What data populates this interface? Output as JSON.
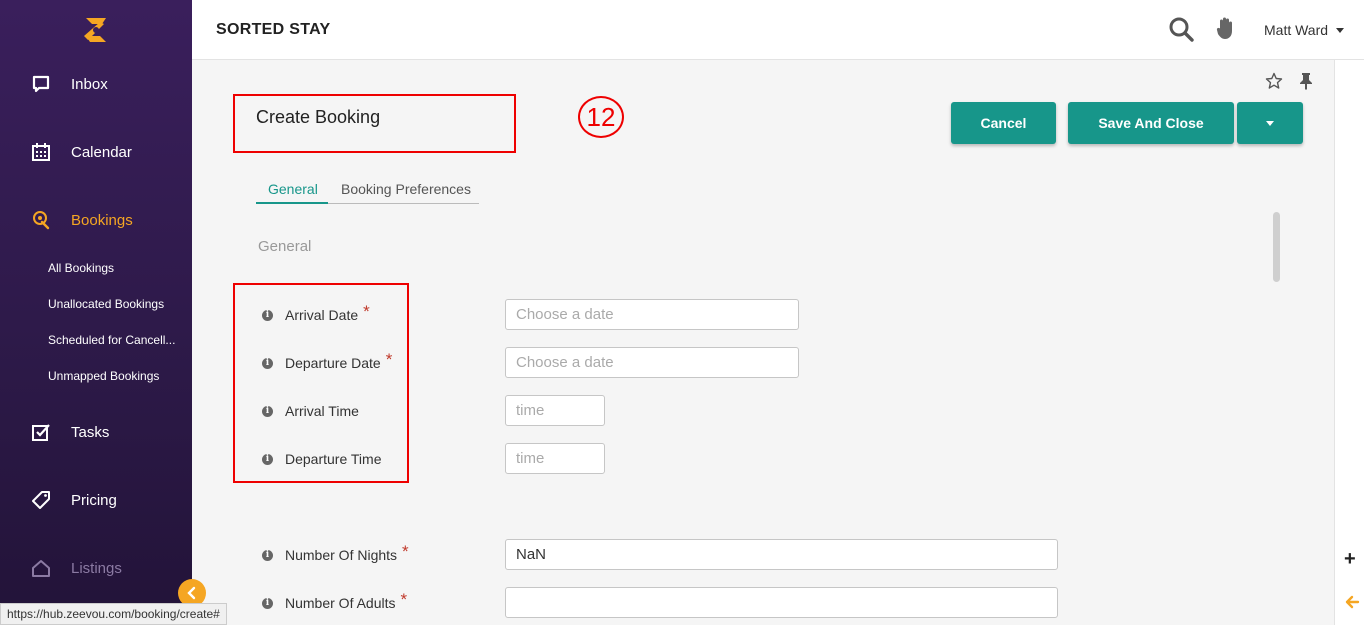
{
  "app": {
    "title": "SORTED STAY",
    "logo_icon": "zeevou-logo",
    "accent": "#f5a623",
    "brand": "#17968a"
  },
  "header": {
    "user_name": "Matt Ward",
    "search_icon": "search-icon",
    "hand_icon": "hand-icon"
  },
  "sidebar": {
    "items": [
      {
        "label": "Inbox",
        "icon": "inbox-icon"
      },
      {
        "label": "Calendar",
        "icon": "calendar-icon"
      },
      {
        "label": "Bookings",
        "icon": "bookings-icon",
        "active": true
      },
      {
        "label": "Tasks",
        "icon": "tasks-icon"
      },
      {
        "label": "Pricing",
        "icon": "tag-icon"
      },
      {
        "label": "Listings",
        "icon": "home-icon"
      }
    ],
    "sub_items": [
      "All Bookings",
      "Unallocated Bookings",
      "Scheduled for Cancell...",
      "Unmapped Bookings"
    ]
  },
  "page": {
    "title": "Create Booking",
    "step_badge": "12",
    "buttons": {
      "cancel": "Cancel",
      "save_close": "Save And Close"
    },
    "tabs": [
      "General",
      "Booking Preferences"
    ],
    "section_label": "General",
    "fields": [
      {
        "label": "Arrival Date",
        "required": "*",
        "placeholder": "Choose a date",
        "value": ""
      },
      {
        "label": "Departure Date",
        "required": "*",
        "placeholder": "Choose a date",
        "value": ""
      },
      {
        "label": "Arrival Time",
        "required": "",
        "placeholder": "time",
        "value": ""
      },
      {
        "label": "Departure Time",
        "required": "",
        "placeholder": "time",
        "value": ""
      },
      {
        "label": "Number Of Nights",
        "required": "*",
        "placeholder": "",
        "value": "NaN"
      },
      {
        "label": "Number Of Adults",
        "required": "*",
        "placeholder": "",
        "value": ""
      }
    ]
  },
  "status_bar": {
    "url": "https://hub.zeevou.com/booking/create#"
  }
}
